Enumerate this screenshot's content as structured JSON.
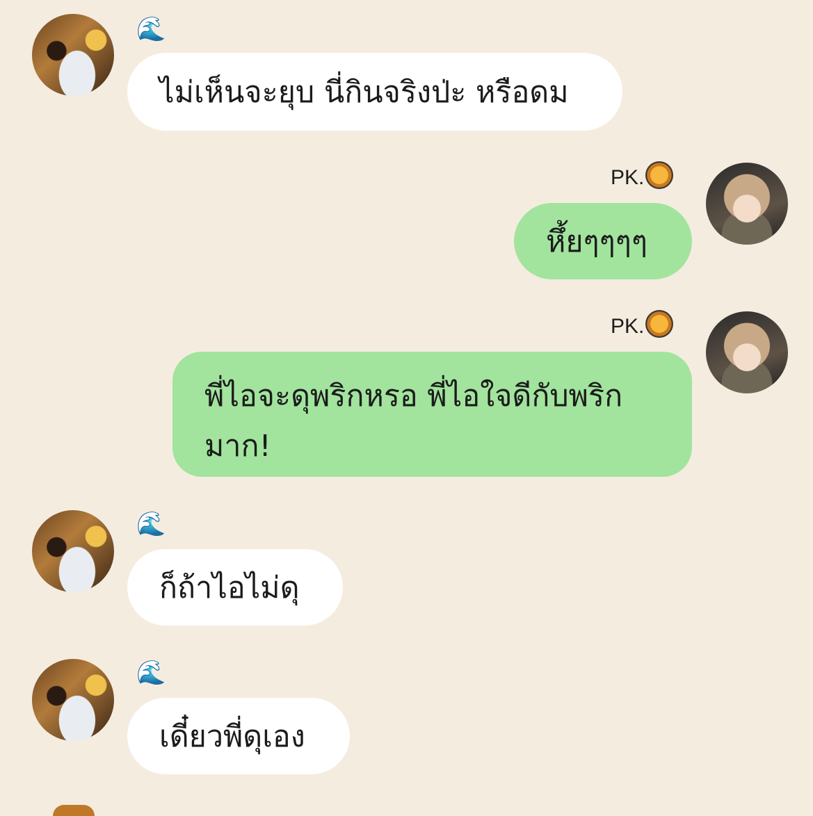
{
  "messages": [
    {
      "side": "left",
      "sender": "🌊",
      "text": "ไม่เห็นจะยุบ นี่กินจริงป่ะ หรือดม"
    },
    {
      "side": "right",
      "sender": "PK.",
      "text": "หึ้ยๆๆๆๆ"
    },
    {
      "side": "right",
      "sender": "PK.",
      "text": "พี่ไอจะดุพริกหรอ พี่ไอใจดีกับพริกมาก!"
    },
    {
      "side": "left",
      "sender": "🌊",
      "text": "ก็ถ้าไอไม่ดุ"
    },
    {
      "side": "left",
      "sender": "🌊",
      "text": "เดี๋ยวพี่ดุเอง"
    }
  ],
  "icons": {
    "left_sender_emoji": "water-wave-icon",
    "right_sender_badge": "paella-pan-icon"
  },
  "colors": {
    "background": "#f5ece0",
    "incoming_bubble": "#ffffff",
    "outgoing_bubble": "#a2e49e"
  }
}
